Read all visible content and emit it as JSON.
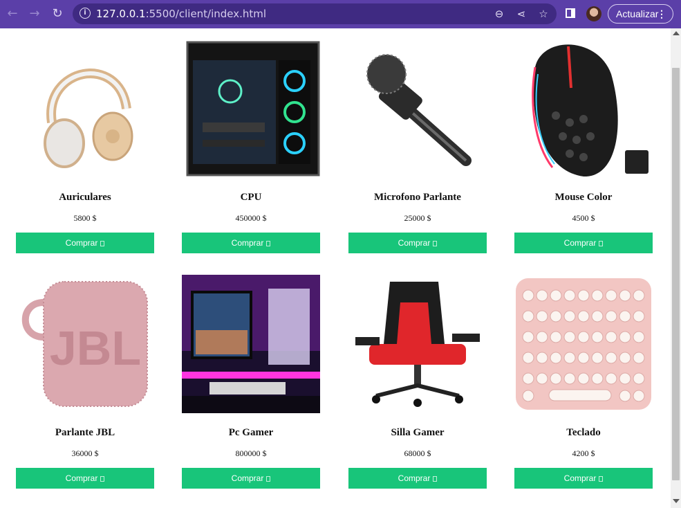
{
  "browser": {
    "url_host": "127.0.0.1",
    "url_path": ":5500/client/index.html",
    "update_label": "Actualizar"
  },
  "products": [
    {
      "name": "Auriculares",
      "price": "5800 $",
      "button": "Comprar"
    },
    {
      "name": "CPU",
      "price": "450000 $",
      "button": "Comprar"
    },
    {
      "name": "Microfono Parlante",
      "price": "25000 $",
      "button": "Comprar"
    },
    {
      "name": "Mouse Color",
      "price": "4500 $",
      "button": "Comprar"
    },
    {
      "name": "Parlante JBL",
      "price": "36000 $",
      "button": "Comprar"
    },
    {
      "name": "Pc Gamer",
      "price": "800000 $",
      "button": "Comprar"
    },
    {
      "name": "Silla Gamer",
      "price": "68000 $",
      "button": "Comprar"
    },
    {
      "name": "Teclado",
      "price": "4200 $",
      "button": "Comprar"
    }
  ],
  "colors": {
    "browser_bar": "#5b3fa8",
    "buy_button": "#18c57a"
  }
}
